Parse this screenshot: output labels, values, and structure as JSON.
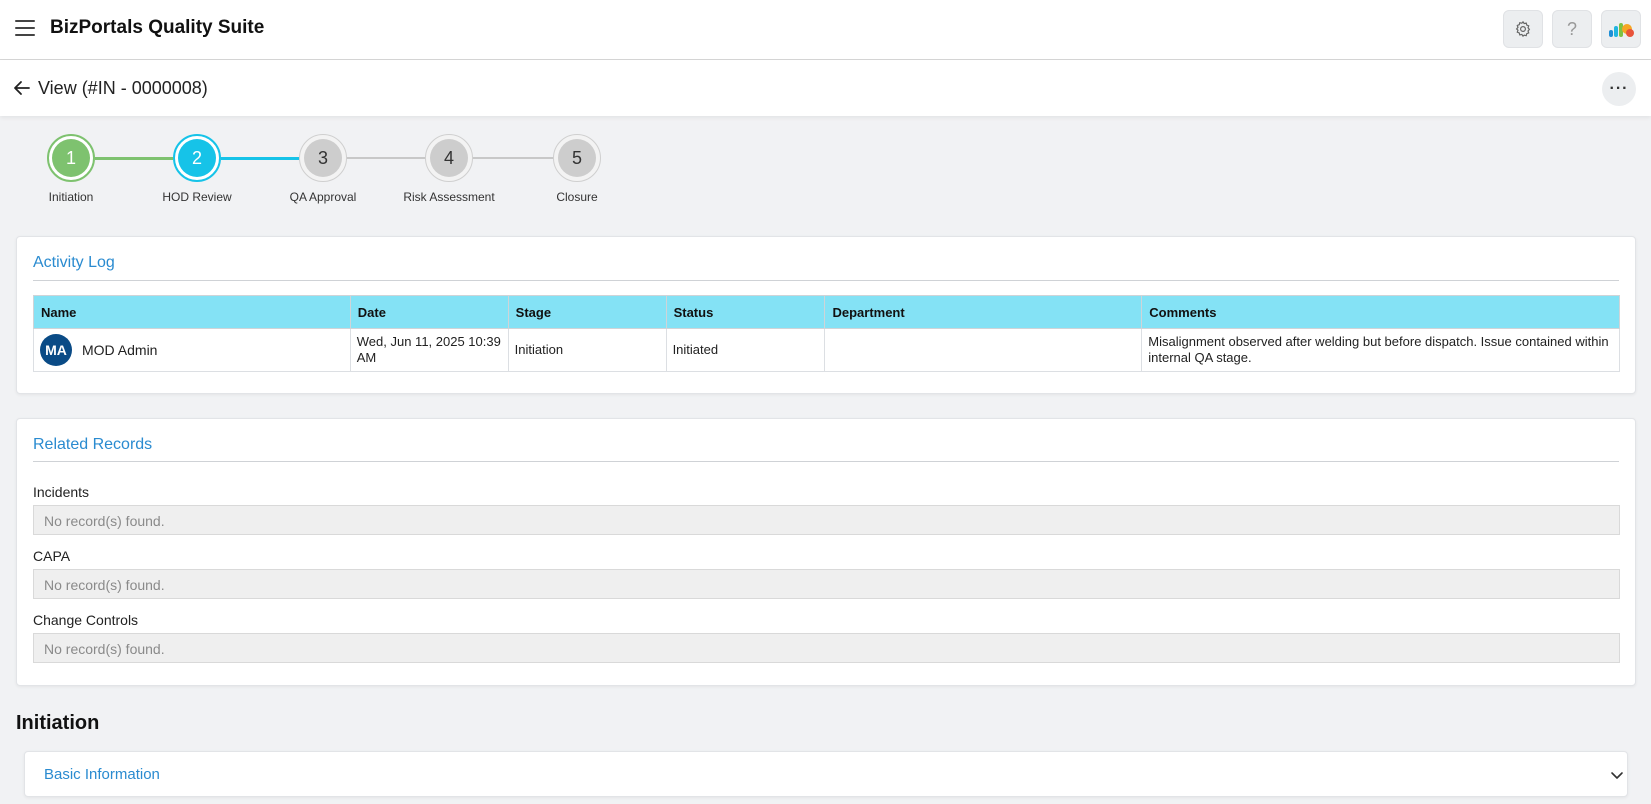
{
  "app": {
    "title": "BizPortals Quality Suite"
  },
  "topbar": {
    "menu_icon": "hamburger-menu-icon",
    "settings_icon": "gear-icon",
    "help_icon": "question-icon",
    "help_glyph": "?",
    "apps_icon": "cloud-logo-icon"
  },
  "header": {
    "back_icon": "arrow-left-icon",
    "view_title": "View (#IN - 0000008)",
    "more_icon": "more-horizontal-icon",
    "more_glyph": "···"
  },
  "stepper": {
    "steps": [
      {
        "number": "1",
        "label": "Initiation",
        "state": "completed"
      },
      {
        "number": "2",
        "label": "HOD Review",
        "state": "current"
      },
      {
        "number": "3",
        "label": "QA Approval",
        "state": "pending"
      },
      {
        "number": "4",
        "label": "Risk Assessment",
        "state": "pending"
      },
      {
        "number": "5",
        "label": "Closure",
        "state": "pending"
      }
    ],
    "colors": {
      "completed": "#7ec26f",
      "current": "#16c3e8",
      "pending": "#cfcfcf"
    }
  },
  "activity_log": {
    "title": "Activity Log",
    "columns": [
      "Name",
      "Date",
      "Stage",
      "Status",
      "Department",
      "Comments"
    ],
    "rows": [
      {
        "avatar": "MA",
        "name": "MOD Admin",
        "date": "Wed, Jun 11, 2025 10:39 AM",
        "stage": "Initiation",
        "status": "Initiated",
        "department": "",
        "comments": "Misalignment observed after welding but before dispatch. Issue contained within internal QA stage."
      }
    ]
  },
  "related_records": {
    "title": "Related Records",
    "sections": [
      {
        "label": "Incidents",
        "empty_text": "No record(s) found."
      },
      {
        "label": "CAPA",
        "empty_text": "No record(s) found."
      },
      {
        "label": "Change Controls",
        "empty_text": "No record(s) found."
      }
    ]
  },
  "initiation": {
    "heading": "Initiation",
    "basic_info_title": "Basic Information",
    "chevron_icon": "chevron-down-icon"
  },
  "colors": {
    "accent": "#2a8bd0",
    "table_header": "#84e2f5",
    "avatar": "#0a4b86"
  }
}
